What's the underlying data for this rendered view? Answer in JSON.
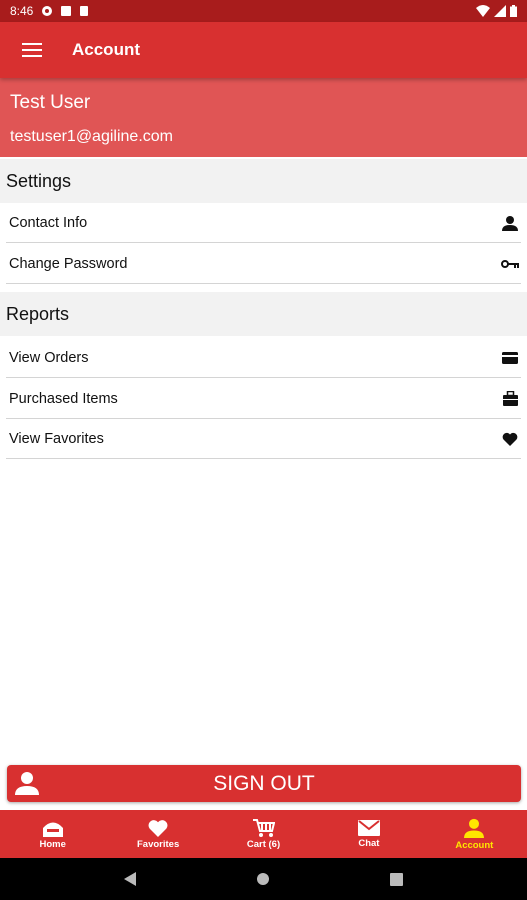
{
  "status_bar": {
    "time": "8:46"
  },
  "app_bar": {
    "title": "Account"
  },
  "profile": {
    "name": "Test User",
    "email": "testuser1@agiline.com"
  },
  "settings": {
    "header": "Settings",
    "items": [
      {
        "label": "Contact Info",
        "icon": "person-icon"
      },
      {
        "label": "Change Password",
        "icon": "key-icon"
      }
    ]
  },
  "reports": {
    "header": "Reports",
    "items": [
      {
        "label": "View Orders",
        "icon": "card-icon"
      },
      {
        "label": "Purchased Items",
        "icon": "briefcase-icon"
      },
      {
        "label": "View Favorites",
        "icon": "heart-icon"
      }
    ]
  },
  "signout": {
    "label": "SIGN OUT"
  },
  "bottom_nav": {
    "items": [
      {
        "label": "Home",
        "icon": "home-icon"
      },
      {
        "label": "Favorites",
        "icon": "heart-icon"
      },
      {
        "label": "Cart (6)",
        "icon": "cart-icon"
      },
      {
        "label": "Chat",
        "icon": "mail-icon"
      },
      {
        "label": "Account",
        "icon": "person-icon",
        "active": true
      }
    ]
  },
  "colors": {
    "primary": "#d83030",
    "profile_bg": "#e05555",
    "active_nav": "#ffe600"
  }
}
